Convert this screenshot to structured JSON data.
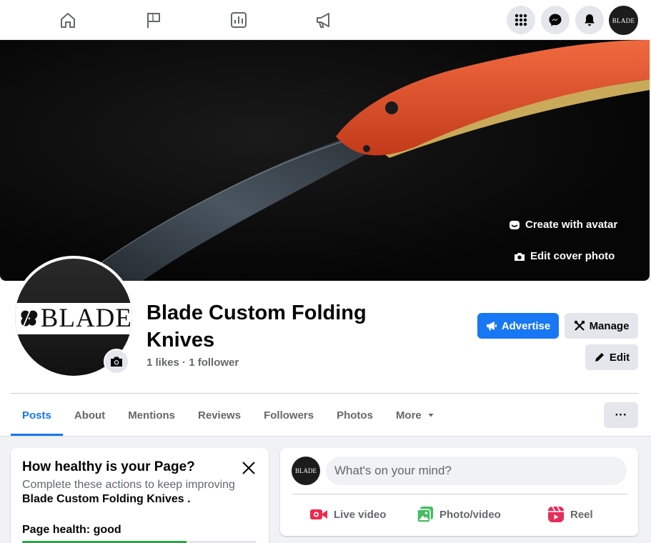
{
  "nav": {
    "icons": [
      "home-icon",
      "flag-icon",
      "insights-icon",
      "megaphone-icon"
    ],
    "right_icons": [
      "menu-grid-icon",
      "messenger-icon",
      "notifications-icon"
    ],
    "account_logo": "BLADE"
  },
  "cover": {
    "create_avatar_label": "Create with avatar",
    "edit_cover_label": "Edit cover photo"
  },
  "page": {
    "logo_text": "BLADE",
    "name": "Blade Custom Folding Knives",
    "likes": "1 likes",
    "separator": "·",
    "followers": "1 follower"
  },
  "actions": {
    "advertise_label": "Advertise",
    "manage_label": "Manage",
    "edit_label": "Edit",
    "more_dots": "···"
  },
  "tabs": [
    {
      "label": "Posts",
      "active": true
    },
    {
      "label": "About",
      "active": false
    },
    {
      "label": "Mentions",
      "active": false
    },
    {
      "label": "Reviews",
      "active": false
    },
    {
      "label": "Followers",
      "active": false
    },
    {
      "label": "Photos",
      "active": false
    },
    {
      "label": "More",
      "active": false
    }
  ],
  "health_card": {
    "title": "How healthy is your Page?",
    "desc_prefix": "Complete these actions to keep improving",
    "desc_page": "Blade Custom Folding Knives",
    "desc_suffix": ".",
    "status": "Page health: good",
    "progress_fraction": 0.7
  },
  "composer": {
    "placeholder": "What's on your mind?",
    "live_video_label": "Live video",
    "photo_video_label": "Photo/video",
    "reel_label": "Reel"
  },
  "colors": {
    "accent": "#1877f2",
    "live_red": "#f02849",
    "photo_green": "#45bd62",
    "reel_pink": "#e42d5a",
    "health_green": "#31a24c"
  }
}
